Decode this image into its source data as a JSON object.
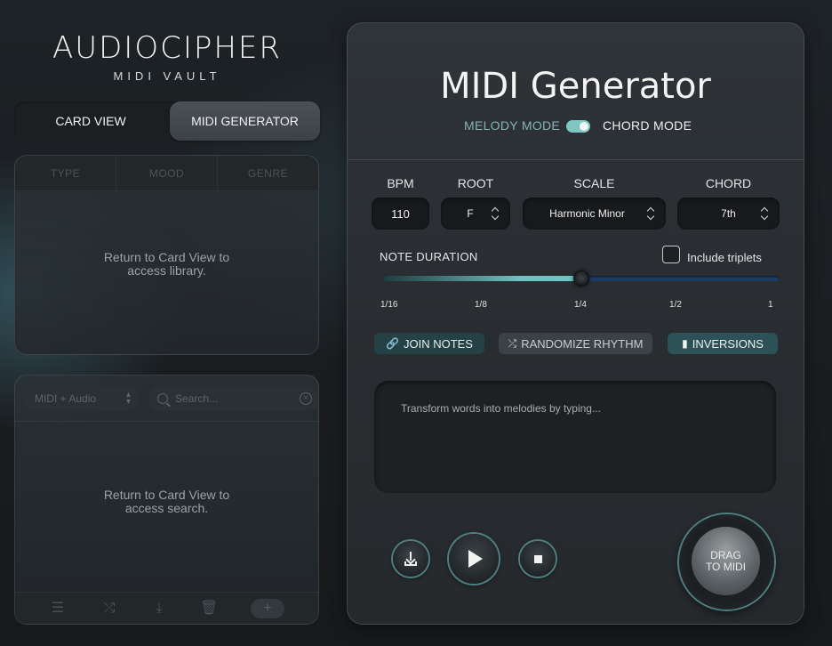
{
  "brand": {
    "name": "AUDIOCIPHER",
    "subtitle": "MIDI VAULT"
  },
  "view_toggle": {
    "card_view": "CARD VIEW",
    "midi_generator": "MIDI GENERATOR",
    "active": "midi_generator"
  },
  "library": {
    "columns": [
      "TYPE",
      "MOOD",
      "GENRE"
    ],
    "message_line1": "Return to Card View to",
    "message_line2": "access library."
  },
  "search_panel": {
    "filter_value": "MIDI + Audio",
    "search_placeholder": "Search...",
    "message_line1": "Return to Card View to",
    "message_line2": "access search.",
    "toolbar_icons": [
      "list-icon",
      "shuffle-icon",
      "download-icon",
      "trash-icon",
      "plus-icon"
    ],
    "add_label": "+"
  },
  "generator": {
    "title": "MIDI Generator",
    "melody_mode": "MELODY MODE",
    "chord_mode": "CHORD MODE",
    "mode_toggle_on": true,
    "bpm_label": "BPM",
    "bpm_value": "110",
    "root_label": "ROOT",
    "root_value": "F",
    "scale_label": "SCALE",
    "scale_value": "Harmonic Minor",
    "chord_label": "CHORD",
    "chord_value": "7th",
    "note_duration_label": "NOTE DURATION",
    "include_triplets_label": "Include triplets",
    "include_triplets_checked": false,
    "duration_ticks": [
      "1/16",
      "1/8",
      "1/4",
      "1/2",
      "1"
    ],
    "duration_selected": "1/4",
    "join_notes": "JOIN NOTES",
    "randomize_rhythm": "RANDOMIZE RHYTHM",
    "inversions": "INVERSIONS",
    "text_placeholder": "Transform words into melodies by typing...",
    "drag_line1": "DRAG",
    "drag_line2": "TO MIDI"
  },
  "colors": {
    "accent": "#7ec7c3",
    "slider_blue": "#1c3d63",
    "chip_teal": "#2c5156"
  }
}
